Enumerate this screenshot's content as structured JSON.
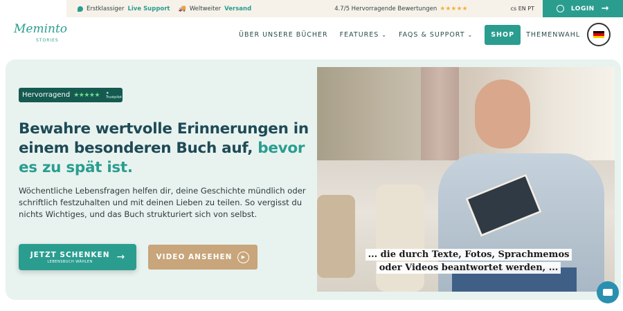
{
  "topbar": {
    "support_prefix": "Erstklassiger",
    "support_highlight": "Live Support",
    "shipping_prefix": "Weltweiter",
    "shipping_highlight": "Versand",
    "ratings_text": "4.7/5 Hervorragende Bewertungen",
    "ratings_stars": "★★★★★",
    "languages": "cs EN PT"
  },
  "login": {
    "label": "LOGIN"
  },
  "logo": {
    "script": "Meminto",
    "sub": "STORIES"
  },
  "nav": {
    "items": [
      {
        "label": "ÜBER UNSERE BÜCHER"
      },
      {
        "label": "FEATURES"
      },
      {
        "label": "FAQS & SUPPORT"
      }
    ],
    "shop_label": "SHOP",
    "themes_label": "THEMENWAHL"
  },
  "hero": {
    "rating_label": "Hervorragend",
    "rating_stars": "★★★★★",
    "rating_provider": "★ Trustpilot",
    "headline_main": "Bewahre wertvolle Erinnerungen in einem besonderen Buch auf, ",
    "headline_accent": "bevor es zu spät ist.",
    "body": "Wöchentliche Lebensfragen helfen dir, deine Geschichte mündlich oder schriftlich festzuhalten und mit deinen Lieben zu teilen. So vergisst du nichts Wichtiges, und das Buch strukturiert sich von selbst.",
    "primary_button": "JETZT SCHENKEN",
    "primary_button_sub": "LEBENSBUCH WÄHLEN",
    "secondary_button": "VIDEO ANSEHEN",
    "caption_line1": "... die durch Texte, Fotos, Sprachmemos",
    "caption_line2": "oder Videos beantwortet werden, ..."
  },
  "colors": {
    "accent": "#2a9d8f",
    "headline": "#1e4a55",
    "secondary_button": "#c8a57a",
    "hero_bg": "#e8f3f0"
  }
}
